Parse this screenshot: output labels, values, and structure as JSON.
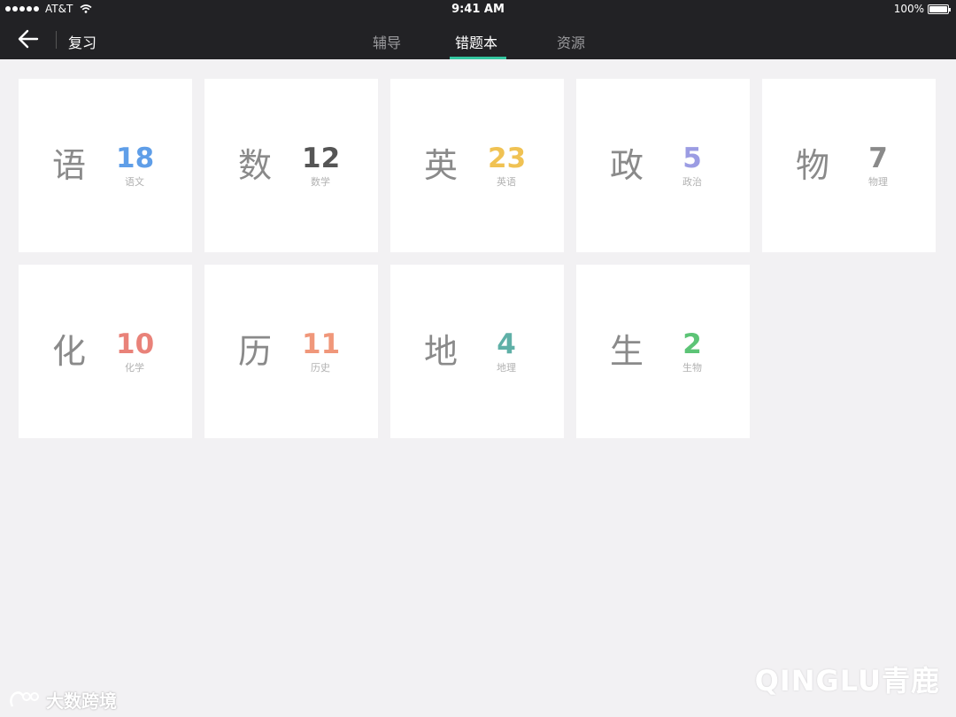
{
  "status": {
    "carrier": "AT&T",
    "time": "9:41 AM",
    "battery": "100%",
    "battery_level": 1.0
  },
  "nav": {
    "back_icon": "arrow-left-icon",
    "title": "复习",
    "tabs": [
      {
        "label": "辅导",
        "active": false
      },
      {
        "label": "错题本",
        "active": true
      },
      {
        "label": "资源",
        "active": false
      }
    ],
    "accent": "#35c7a0"
  },
  "subjects": [
    {
      "char": "语",
      "count": "18",
      "label": "语文",
      "color": "#5f9ee8"
    },
    {
      "char": "数",
      "count": "12",
      "label": "数学",
      "color": "#555555"
    },
    {
      "char": "英",
      "count": "23",
      "label": "英语",
      "color": "#f0c253"
    },
    {
      "char": "政",
      "count": "5",
      "label": "政治",
      "color": "#9b9ce3"
    },
    {
      "char": "物",
      "count": "7",
      "label": "物理",
      "color": "#8a8a8a"
    },
    {
      "char": "化",
      "count": "10",
      "label": "化学",
      "color": "#e98279"
    },
    {
      "char": "历",
      "count": "11",
      "label": "历史",
      "color": "#f0977a"
    },
    {
      "char": "地",
      "count": "4",
      "label": "地理",
      "color": "#5fb0a7"
    },
    {
      "char": "生",
      "count": "2",
      "label": "生物",
      "color": "#5cc476"
    }
  ],
  "watermarks": {
    "left": "大数跨境",
    "right": "QINGLU青鹿"
  }
}
